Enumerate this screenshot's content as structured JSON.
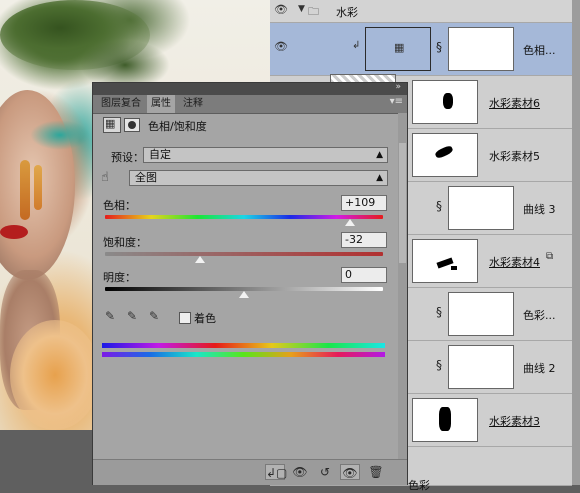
{
  "layers_panel": {
    "group": {
      "name": "水彩"
    },
    "layers": [
      {
        "name": "色相...",
        "type": "adjustment",
        "selected": true,
        "underlined": false
      },
      {
        "name": "水彩素材6",
        "type": "pixel",
        "selected": false,
        "underlined": true
      },
      {
        "name": "水彩素材5",
        "type": "pixel",
        "selected": false,
        "underlined": false
      },
      {
        "name": "曲线 3",
        "type": "adjustment",
        "selected": false,
        "underlined": false
      },
      {
        "name": "水彩素材4",
        "type": "pixel",
        "selected": false,
        "underlined": true
      },
      {
        "name": "色彩...",
        "type": "adjustment",
        "selected": false,
        "underlined": false
      },
      {
        "name": "曲线 2",
        "type": "adjustment",
        "selected": false,
        "underlined": false
      },
      {
        "name": "水彩素材3",
        "type": "pixel",
        "selected": false,
        "underlined": true
      }
    ],
    "bottom_partial_label": "色彩"
  },
  "properties_panel": {
    "tabs": [
      {
        "label": "图层复合",
        "active": false
      },
      {
        "label": "属性",
        "active": true
      },
      {
        "label": "注释",
        "active": false
      }
    ],
    "adjustment_title": "色相/饱和度",
    "preset_label": "预设：",
    "preset_value": "自定",
    "channel_value": "全图",
    "hue": {
      "label": "色相：",
      "value": "+109",
      "fraction": 0.88
    },
    "saturation": {
      "label": "饱和度：",
      "value": "-32",
      "fraction": 0.34
    },
    "lightness": {
      "label": "明度：",
      "value": "0",
      "fraction": 0.5
    },
    "colorize_label": "着色",
    "colorize_checked": false
  },
  "colors": {
    "selected_layer": "#a5b8d8",
    "panel_bg": "#a5a5a5",
    "layers_bg": "#cfcfcf"
  }
}
